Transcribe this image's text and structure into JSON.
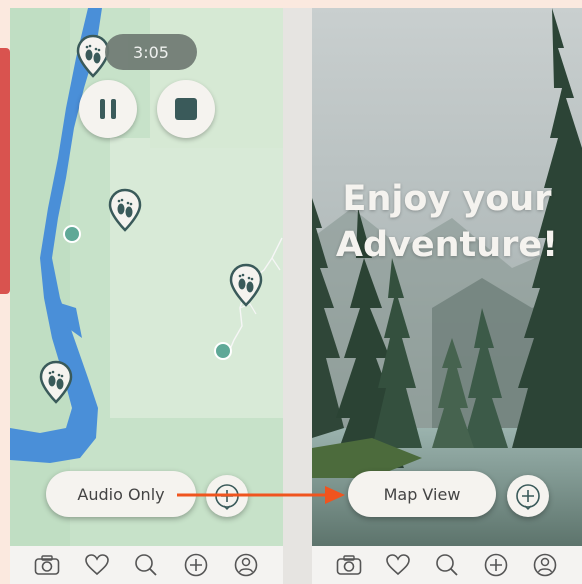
{
  "left_screen": {
    "timer": "3:05",
    "audio_button": "Audio Only"
  },
  "right_screen": {
    "headline_line1": "Enjoy your",
    "headline_line2": "Adventure!",
    "map_button": "Map View"
  },
  "tabbar_icons": [
    "camera-icon",
    "heart-icon",
    "search-icon",
    "plus-icon",
    "user-icon"
  ],
  "colors": {
    "background": "#fbe9df",
    "map_land": "#c7e2c9",
    "map_water": "#4a8fd8",
    "marker": "#3a5a5a",
    "accent_arrow": "#f0541e",
    "timer_bg": "#6f7a73"
  }
}
